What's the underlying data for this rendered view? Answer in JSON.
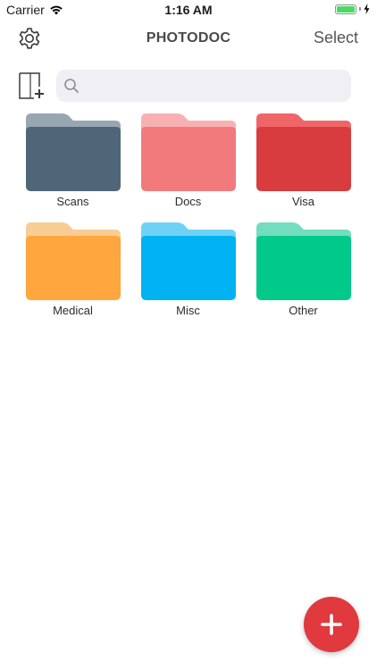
{
  "status_bar": {
    "carrier": "Carrier",
    "time": "1:16 AM",
    "battery_level": 1.0
  },
  "nav": {
    "title": "PHOTODOC",
    "select_label": "Select",
    "settings_icon": "gear-icon"
  },
  "search": {
    "placeholder": "",
    "value": "",
    "icon": "search-icon"
  },
  "toolbar": {
    "new_folder_icon": "new-folder-icon"
  },
  "folders": [
    {
      "label": "Scans",
      "color": "#4e6677",
      "tab_color": "#98a6b1"
    },
    {
      "label": "Docs",
      "color": "#f27a7c",
      "tab_color": "#f7b1b2"
    },
    {
      "label": "Visa",
      "color": "#d83c3f",
      "tab_color": "#f06568"
    },
    {
      "label": "Medical",
      "color": "#ffa63e",
      "tab_color": "#f8cd94"
    },
    {
      "label": "Misc",
      "color": "#00b2f2",
      "tab_color": "#6fd2f4"
    },
    {
      "label": "Other",
      "color": "#00c98a",
      "tab_color": "#72ddbf"
    }
  ],
  "fab": {
    "icon": "plus-icon",
    "color": "#e0393e"
  },
  "colors": {
    "battery": "#4cd964",
    "search_bg": "#efeff4"
  }
}
